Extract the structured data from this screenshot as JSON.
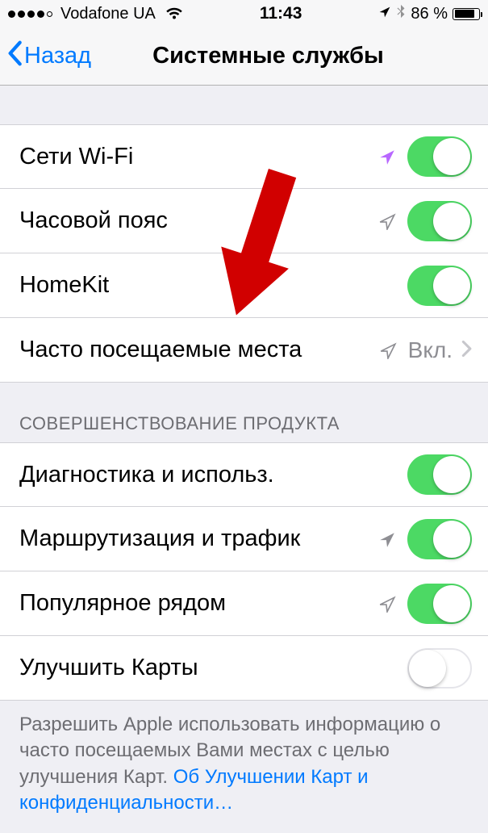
{
  "status": {
    "carrier": "Vodafone UA",
    "time": "11:43",
    "battery_pct": "86 %",
    "battery_fill_pct": 86
  },
  "nav": {
    "back": "Назад",
    "title": "Системные службы"
  },
  "rows1": {
    "wifi": {
      "label": "Сети Wi-Fi"
    },
    "timezone": {
      "label": "Часовой пояс"
    },
    "homekit": {
      "label": "HomeKit"
    },
    "frequent": {
      "label": "Часто посещаемые места",
      "value": "Вкл."
    }
  },
  "section2_header": "СОВЕРШЕНСТВОВАНИЕ ПРОДУКТА",
  "rows2": {
    "diagnostics": {
      "label": "Диагностика и использ."
    },
    "routing": {
      "label": "Маршрутизация и трафик"
    },
    "popular": {
      "label": "Популярное рядом"
    },
    "maps": {
      "label": "Улучшить Карты"
    }
  },
  "footer": {
    "text": "Разрешить Apple использовать информацию о часто посещаемых Вами местах с целью улучшения Карт. ",
    "link": "Об Улучшении Карт и конфиденциальности…"
  }
}
